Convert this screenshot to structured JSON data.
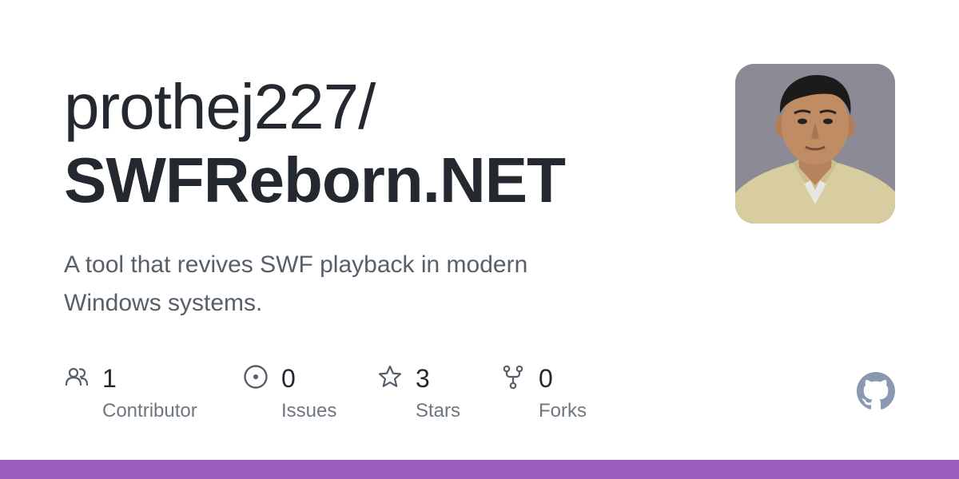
{
  "repo": {
    "owner": "prothej227/",
    "name": "SWFReborn.NET",
    "description": "A tool that revives SWF playback in modern Windows systems."
  },
  "stats": {
    "contributors": {
      "count": "1",
      "label": "Contributor",
      "icon": "people-icon"
    },
    "issues": {
      "count": "0",
      "label": "Issues",
      "icon": "issue-icon"
    },
    "stars": {
      "count": "3",
      "label": "Stars",
      "icon": "star-icon"
    },
    "forks": {
      "count": "0",
      "label": "Forks",
      "icon": "fork-icon"
    }
  },
  "colors": {
    "title": "#24292f",
    "description": "#57606a",
    "icon": "#57606a",
    "github_logo": "#8b98b1",
    "language_bar": "#9b5fc0"
  }
}
